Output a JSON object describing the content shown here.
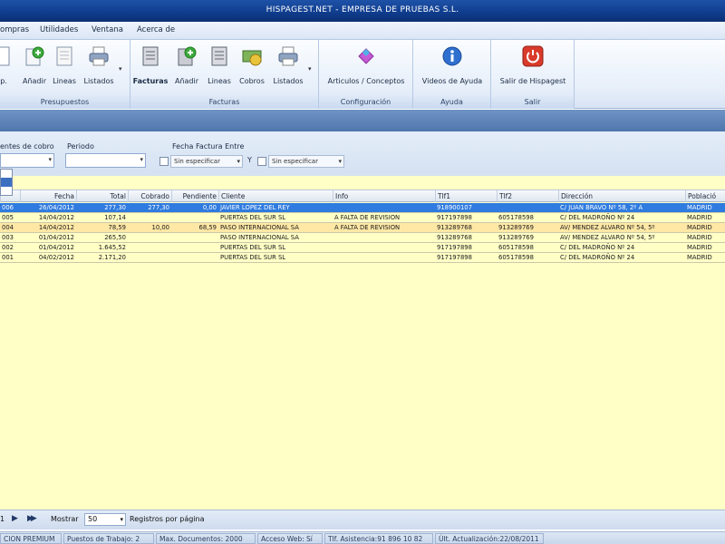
{
  "window": {
    "title": "HISPAGEST.NET - EMPRESA DE PRUEBAS S.L."
  },
  "menu": {
    "items": [
      "ompras",
      "Utilidades",
      "Ventana",
      "Acerca de"
    ]
  },
  "ribbon": {
    "groups": [
      {
        "label": "Presupuestos",
        "buttons": [
          "p.",
          "Añadir",
          "Lineas",
          "Listados"
        ]
      },
      {
        "label": "Facturas",
        "buttons": [
          "Facturas",
          "Añadir",
          "Lineas",
          "Cobros",
          "Listados"
        ]
      },
      {
        "label": "Configuración",
        "buttons": [
          "Articulos / Conceptos"
        ]
      },
      {
        "label": "Ayuda",
        "buttons": [
          "Videos de Ayuda"
        ]
      },
      {
        "label": "Salir",
        "buttons": [
          "Salir de Hispagest"
        ]
      }
    ],
    "dropdown_glyph": "▾"
  },
  "filters": {
    "cobro_label": "entes de cobro",
    "periodo_label": "Periodo",
    "fecha_label": "Fecha Factura Entre",
    "date_from_text": "Sin especificar",
    "between_label": "Y",
    "date_to_text": "Sin especificar",
    "combo_arrow": "▾"
  },
  "grid": {
    "columns": [
      "Fecha",
      "Total",
      "Cobrado",
      "Pendiente",
      "Cliente",
      "Info",
      "Tlf1",
      "Tlf2",
      "Dirección",
      "Població"
    ],
    "rows": [
      {
        "num": "006",
        "fecha": "26/04/2012",
        "total": "277,30",
        "cobrado": "277,30",
        "pendiente": "0,00",
        "cliente": "JAVIER LOPEZ DEL REY",
        "info": "",
        "tlf1": "918900107",
        "tlf2": "",
        "direccion": "C/ JUAN BRAVO Nº 58, 2º A",
        "poblacion": "MADRID",
        "selected": true
      },
      {
        "num": "005",
        "fecha": "14/04/2012",
        "total": "107,14",
        "cobrado": "",
        "pendiente": "",
        "cliente": "PUERTAS DEL SUR SL",
        "info": "A FALTA DE REVISION",
        "tlf1": "917197898",
        "tlf2": "605178598",
        "direccion": "C/ DEL MADROÑO Nº 24",
        "poblacion": "MADRID",
        "selected": false
      },
      {
        "num": "004",
        "fecha": "14/04/2012",
        "total": "78,59",
        "cobrado": "10,00",
        "pendiente": "68,59",
        "cliente": "PASO INTERNACIONAL SA",
        "info": "A FALTA DE REVISION",
        "tlf1": "913289768",
        "tlf2": "913289769",
        "direccion": "AV/ MENDEZ ALVARO Nº 54, 5º",
        "poblacion": "MADRID",
        "selected": false
      },
      {
        "num": "003",
        "fecha": "01/04/2012",
        "total": "265,50",
        "cobrado": "",
        "pendiente": "",
        "cliente": "PASO INTERNACIONAL SA",
        "info": "",
        "tlf1": "913289768",
        "tlf2": "913289769",
        "direccion": "AV/ MENDEZ ALVARO Nº 54, 5º",
        "poblacion": "MADRID",
        "selected": false
      },
      {
        "num": "002",
        "fecha": "01/04/2012",
        "total": "1.645,52",
        "cobrado": "",
        "pendiente": "",
        "cliente": "PUERTAS DEL SUR SL",
        "info": "",
        "tlf1": "917197898",
        "tlf2": "605178598",
        "direccion": "C/ DEL MADROÑO Nº 24",
        "poblacion": "MADRID",
        "selected": false
      },
      {
        "num": "001",
        "fecha": "04/02/2012",
        "total": "2.171,20",
        "cobrado": "",
        "pendiente": "",
        "cliente": "PUERTAS DEL SUR SL",
        "info": "",
        "tlf1": "917197898",
        "tlf2": "605178598",
        "direccion": "C/ DEL MADROÑO Nº 24",
        "poblacion": "MADRID",
        "selected": false
      }
    ]
  },
  "pager": {
    "page_num": "1",
    "show_label": "Mostrar",
    "page_size": "50",
    "per_page_label": "Registros por página",
    "next_glyph": "▶",
    "last_glyph": "▶▶"
  },
  "status": {
    "items": [
      "CION PREMIUM",
      "Puestos de Trabajo: 2",
      "Max. Documentos: 2000",
      "Acceso Web: Sí",
      "Tlf. Asistencia:91 896 10 82",
      "Últ. Actualización:22/08/2011"
    ]
  },
  "colors": {
    "selected_row": "#2f7be0",
    "pending_row": "#ffe8a6",
    "plain_row": "#ffffc6",
    "grid_background": "#ffffc6"
  }
}
